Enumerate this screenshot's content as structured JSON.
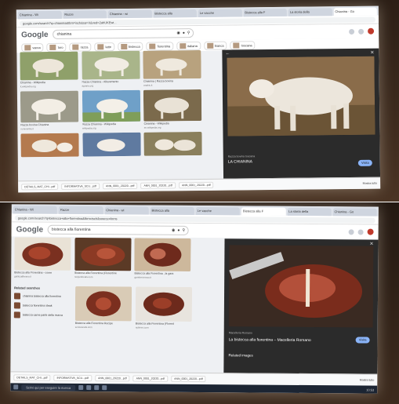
{
  "photos": [
    {
      "tabs": [
        "Chianina - Wi",
        "Razze",
        "Chianina - wi",
        "Bistecca alla",
        "Le vacche",
        "Bistecca alla F",
        "La storia della",
        "Chianina - Go"
      ],
      "url": "google.com/search?q=chianina&tbm=isch&sa=X&ved=2ahUKEwi...",
      "search_query": "chianina",
      "chips": [
        "vacca",
        "toro",
        "razza",
        "latte",
        "bistecca",
        "fiorentina",
        "italiana",
        "bianca",
        "toscana",
        "vitello"
      ],
      "tiles": [
        {
          "caption": "Chianina - Wikipedia",
          "source": "it.wikipedia.org"
        },
        {
          "caption": "Razza Chianina - Allevamento",
          "source": "agraria.org"
        },
        {
          "caption": "Chianina | Razza bovina",
          "source": "anabic.it"
        },
        {
          "caption": "Razza bovina Chianina",
          "source": "ruminantia.it"
        },
        {
          "caption": "Razza Chianina - Wikipedia",
          "source": "wikipedia.org"
        },
        {
          "caption": "Chianina - Wikipedia",
          "source": "en.wikipedia.org"
        },
        {
          "caption": "Vacca Chianina",
          "source": "toscana.it"
        },
        {
          "caption": "Vitelli Chianini",
          "source": "agraria.org"
        },
        {
          "caption": "Chianina al pascolo",
          "source": "fattoria.it"
        }
      ],
      "panel": {
        "title": "LA CHIANINA",
        "subtitle": "Razza bovina toscana",
        "visit_label": "Visita"
      },
      "downloads": [
        "DETAILS_MAT_CHI...pdf",
        "INFORMATIVA_SCU...pdf",
        "ANN_0001_20220...pdf",
        "ANN_0001_20220...pdf",
        "ANN_0001_20220...pdf"
      ],
      "show_all": "Mostra tutto"
    },
    {
      "tabs": [
        "Chianina - Wi",
        "Razze",
        "Chianina - wi",
        "Bistecca alla",
        "Le vacche",
        "Bistecca alla F",
        "La storia della",
        "Chianina - Go"
      ],
      "url": "google.com/search?q=bistecca+alla+fiorentina&tbm=isch&source=lnms",
      "search_query": "bistecca alla fiorentina",
      "tiles": [
        {
          "caption": "Bistecca alla Fiorentina - come",
          "source": "giallozafferano.it"
        },
        {
          "caption": "Bistecca alla Fiorentina (Florentine",
          "source": "recipetineats.com"
        },
        {
          "caption": "Bistecca alla Fiorentina , la gara",
          "source": "gamberorosso.it"
        },
        {
          "caption": "Bistecca alla Fiorentina Recipe",
          "source": "seriouseats.com"
        },
        {
          "caption": "Bistecca alla Fiorentina (Florent",
          "source": "nytimes.com"
        }
      ],
      "related_title": "Related searches",
      "related": [
        "chianina bistecca alla fiorentina",
        "bistecca fiorentina steak",
        "bistecca carne parte della mucca"
      ],
      "panel": {
        "title": "La bistecca alla fiorentina – Macelleria Romano",
        "subtitle": "Macelleria Romano",
        "visit_label": "Visita",
        "related_images": "Related images"
      },
      "downloads": [
        "DETAILS_MAT_CHI...pdf",
        "INFORMATIVA_SCU...pdf",
        "ANN_0001_20220...pdf",
        "ANN_0001_20220...pdf",
        "ANN_0001_20220...pdf"
      ],
      "show_all": "Mostra tutto",
      "taskbar_search": "Scrivi qui per eseguire la ricerca",
      "clock": "10:53"
    }
  ],
  "google_logo": "Google",
  "colors": {
    "panel_bg": "#2b2b2b",
    "accent": "#8ab4f8",
    "cow_white": "#e8e2d8",
    "meat_red": "#8a3b28"
  }
}
